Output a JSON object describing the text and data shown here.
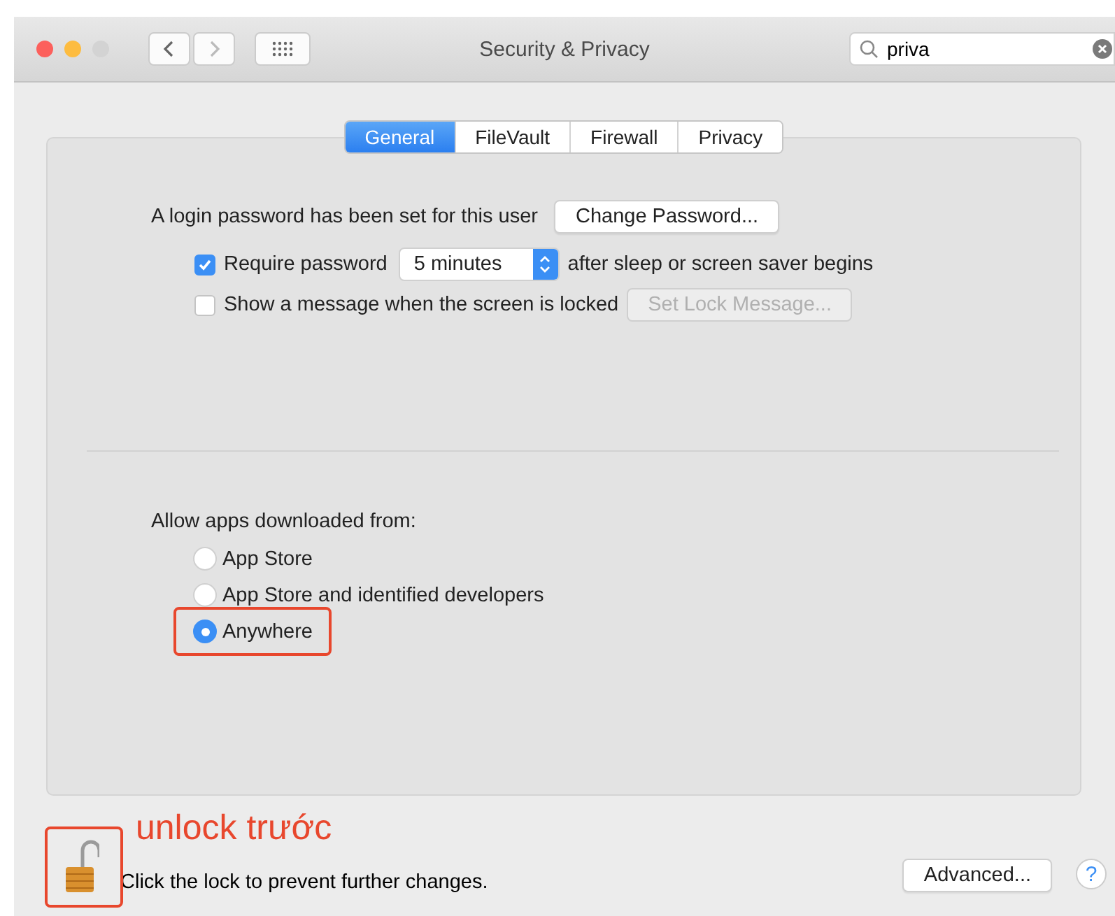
{
  "window": {
    "title": "Security & Privacy"
  },
  "search": {
    "value": "priva"
  },
  "tabs": [
    {
      "label": "General",
      "selected": true
    },
    {
      "label": "FileVault",
      "selected": false
    },
    {
      "label": "Firewall",
      "selected": false
    },
    {
      "label": "Privacy",
      "selected": false
    }
  ],
  "login": {
    "text": "A login password has been set for this user",
    "button": "Change Password..."
  },
  "require_password": {
    "label": "Require password",
    "checked": true,
    "delay": "5 minutes",
    "suffix": "after sleep or screen saver begins"
  },
  "lock_message": {
    "label": "Show a message when the screen is locked",
    "checked": false,
    "button": "Set Lock Message...",
    "button_disabled": true
  },
  "allow_apps": {
    "label": "Allow apps downloaded from:",
    "options": [
      {
        "label": "App Store",
        "selected": false,
        "highlighted": false
      },
      {
        "label": "App Store and identified developers",
        "selected": false,
        "highlighted": false
      },
      {
        "label": "Anywhere",
        "selected": true,
        "highlighted": true
      }
    ]
  },
  "footer": {
    "lock_open": true,
    "lock_highlighted": true,
    "annotation": "unlock trước",
    "text": "Click the lock to prevent further changes.",
    "button": "Advanced...",
    "help": "?"
  }
}
